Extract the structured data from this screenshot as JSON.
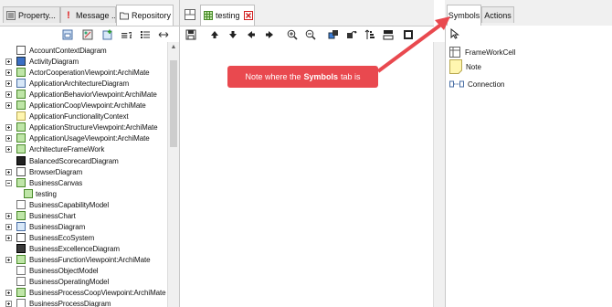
{
  "left_tabs": [
    {
      "label": "Property..."
    },
    {
      "label": "Message ..."
    },
    {
      "label": "Repository"
    }
  ],
  "tree": [
    {
      "label": "AccountContextDiagram",
      "expander": "none"
    },
    {
      "label": "ActivityDiagram",
      "expander": "plus"
    },
    {
      "label": "ActorCooperationViewpoint:ArchiMate",
      "expander": "plus"
    },
    {
      "label": "ApplicationArchitectureDiagram",
      "expander": "plus"
    },
    {
      "label": "ApplicationBehaviorViewpoint:ArchiMate",
      "expander": "plus"
    },
    {
      "label": "ApplicationCoopViewpoint:ArchiMate",
      "expander": "plus"
    },
    {
      "label": "ApplicationFunctionalityContext",
      "expander": "none"
    },
    {
      "label": "ApplicationStructureViewpoint:ArchiMate",
      "expander": "plus"
    },
    {
      "label": "ApplicationUsageViewpoint:ArchiMate",
      "expander": "plus"
    },
    {
      "label": "ArchitectureFrameWork",
      "expander": "plus"
    },
    {
      "label": "BalancedScorecardDiagram",
      "expander": "none"
    },
    {
      "label": "BrowserDiagram",
      "expander": "plus"
    },
    {
      "label": "BusinessCanvas",
      "expander": "minus"
    },
    {
      "label": "testing",
      "expander": "child"
    },
    {
      "label": "BusinessCapabilityModel",
      "expander": "none"
    },
    {
      "label": "BusinessChart",
      "expander": "plus"
    },
    {
      "label": "BusinessDiagram",
      "expander": "plus"
    },
    {
      "label": "BusinessEcoSystem",
      "expander": "plus"
    },
    {
      "label": "BusinessExcellenceDiagram",
      "expander": "none"
    },
    {
      "label": "BusinessFunctionViewpoint:ArchiMate",
      "expander": "plus"
    },
    {
      "label": "BusinessObjectModel",
      "expander": "none"
    },
    {
      "label": "BusinessOperatingModel",
      "expander": "none"
    },
    {
      "label": "BusinessProcessCoopViewpoint:ArchiMate",
      "expander": "plus"
    },
    {
      "label": "BusinessProcessDiagram",
      "expander": "plus"
    }
  ],
  "center_tab": {
    "label": "testing"
  },
  "right_tabs": [
    {
      "label": "Symbols"
    },
    {
      "label": "Actions"
    }
  ],
  "palette": [
    {
      "label": "FrameWorkCell"
    },
    {
      "label": "Note"
    },
    {
      "label": "Connection"
    }
  ],
  "callout": {
    "prefix": "Note where the",
    "bold": "Symbols",
    "suffix": "tab is"
  },
  "colors": {
    "callout": "#e9494f",
    "close_tab": "#d22020"
  }
}
